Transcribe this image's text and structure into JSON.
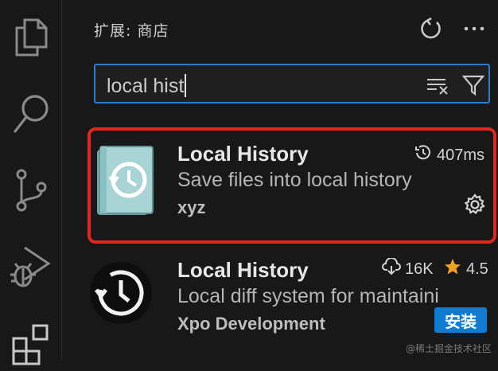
{
  "sidebar": {
    "title": "扩展: 商店"
  },
  "header_icons": {
    "refresh": "refresh-icon",
    "more": "more-icon"
  },
  "search": {
    "value": "local hist",
    "clear_icon": "clear-filter-icon",
    "filter_icon": "filter-icon"
  },
  "activity_bar": [
    "explorer-icon",
    "search-icon",
    "source-control-icon",
    "run-debug-icon",
    "extensions-icon"
  ],
  "extensions": [
    {
      "name": "Local History",
      "description": "Save files into local history",
      "publisher": "xyz",
      "stat": "407ms",
      "stat_icon": "history-icon",
      "action_icon": "gear-icon"
    },
    {
      "name": "Local History",
      "description": "Local diff system for maintaini",
      "publisher": "Xpo Development",
      "downloads": "16K",
      "rating": "4.5",
      "install_label": "安装"
    }
  ],
  "watermark": "@稀土掘金技术社区",
  "colors": {
    "accent": "#0e7dd1",
    "highlight": "#e0261d",
    "star": "#f2a321",
    "focus": "#2f7bd0"
  }
}
